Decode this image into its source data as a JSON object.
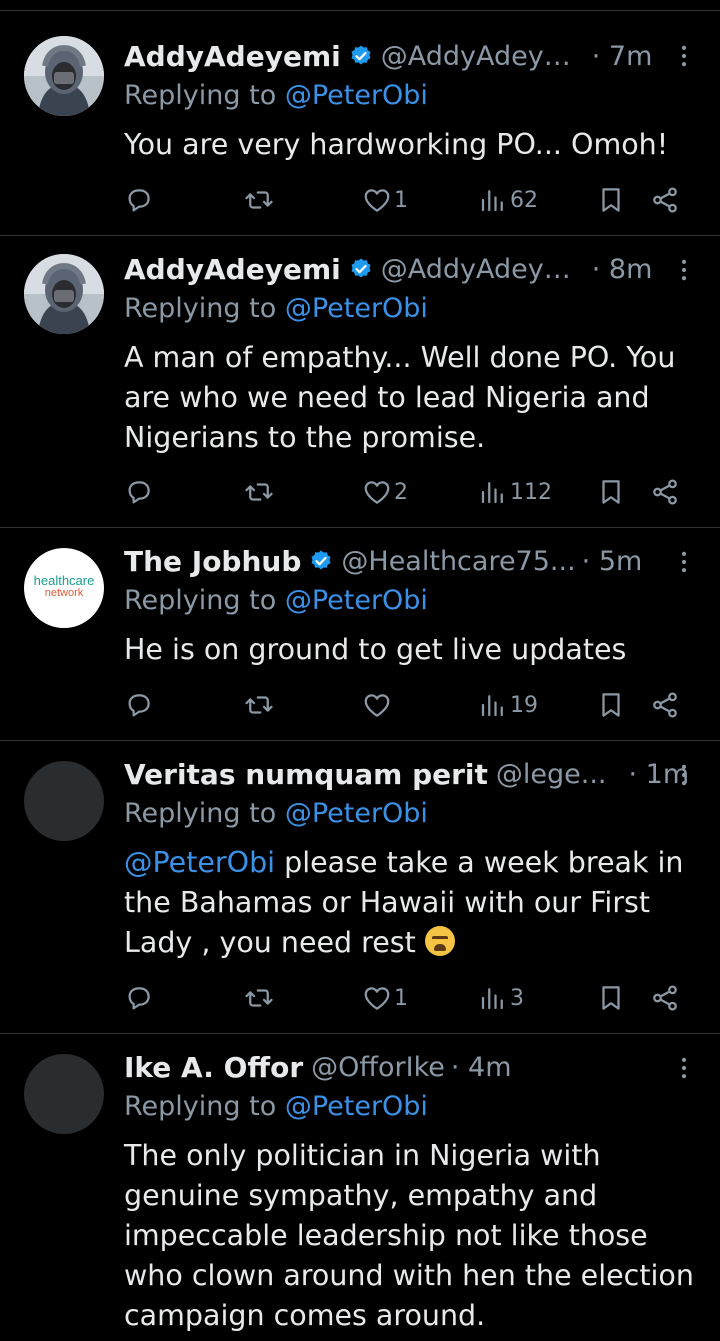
{
  "tweets": [
    {
      "name": "AddyAdeyemi",
      "verified": true,
      "handle": "@AddyAdeye...",
      "time": "· 7m",
      "replying_prefix": "Replying to ",
      "replying_to": "@PeterObi",
      "text": "You are very hardworking PO... Omoh!",
      "replies": "",
      "retweets": "",
      "likes": "1",
      "views": "62"
    },
    {
      "name": "AddyAdeyemi",
      "verified": true,
      "handle": "@AddyAdeye...",
      "time": "· 8m",
      "replying_prefix": "Replying to ",
      "replying_to": "@PeterObi",
      "text": "A man of empathy... Well done PO. You are who we need to lead Nigeria and Nigerians to the promise.",
      "replies": "",
      "retweets": "",
      "likes": "2",
      "views": "112"
    },
    {
      "name": "The Jobhub",
      "verified": true,
      "handle": "@Healthcare75...",
      "time": "· 5m",
      "replying_prefix": "Replying to ",
      "replying_to": "@PeterObi",
      "avatar_text_1": "healthcare",
      "avatar_text_2": "network",
      "text": "He is on ground to get live updates",
      "replies": "",
      "retweets": "",
      "likes": "",
      "views": "19"
    },
    {
      "name": "Veritas numquam perit",
      "verified": false,
      "handle": "@lege...",
      "time": "· 1m",
      "replying_prefix": "Replying to ",
      "replying_to": "@PeterObi",
      "text_mention": "@PeterObi",
      "text": " please take a week break in the Bahamas or Hawaii with our First Lady , you need rest ",
      "emoji": "weary-face",
      "replies": "",
      "retweets": "",
      "likes": "1",
      "views": "3"
    },
    {
      "name": "Ike A. Offor",
      "verified": false,
      "handle": "@OfforIke",
      "time": "· 4m",
      "replying_prefix": "Replying to ",
      "replying_to": "@PeterObi",
      "text": "The only politician in Nigeria with genuine sympathy, empathy and impeccable leadership not like those who clown around with hen the election campaign comes around."
    }
  ],
  "colors": {
    "background": "#000000",
    "primary_text": "#e7e9ea",
    "secondary_text": "#8b98a5",
    "mention": "#3b91e6",
    "verified": "#1d9bf0",
    "divider": "#2f3336"
  }
}
